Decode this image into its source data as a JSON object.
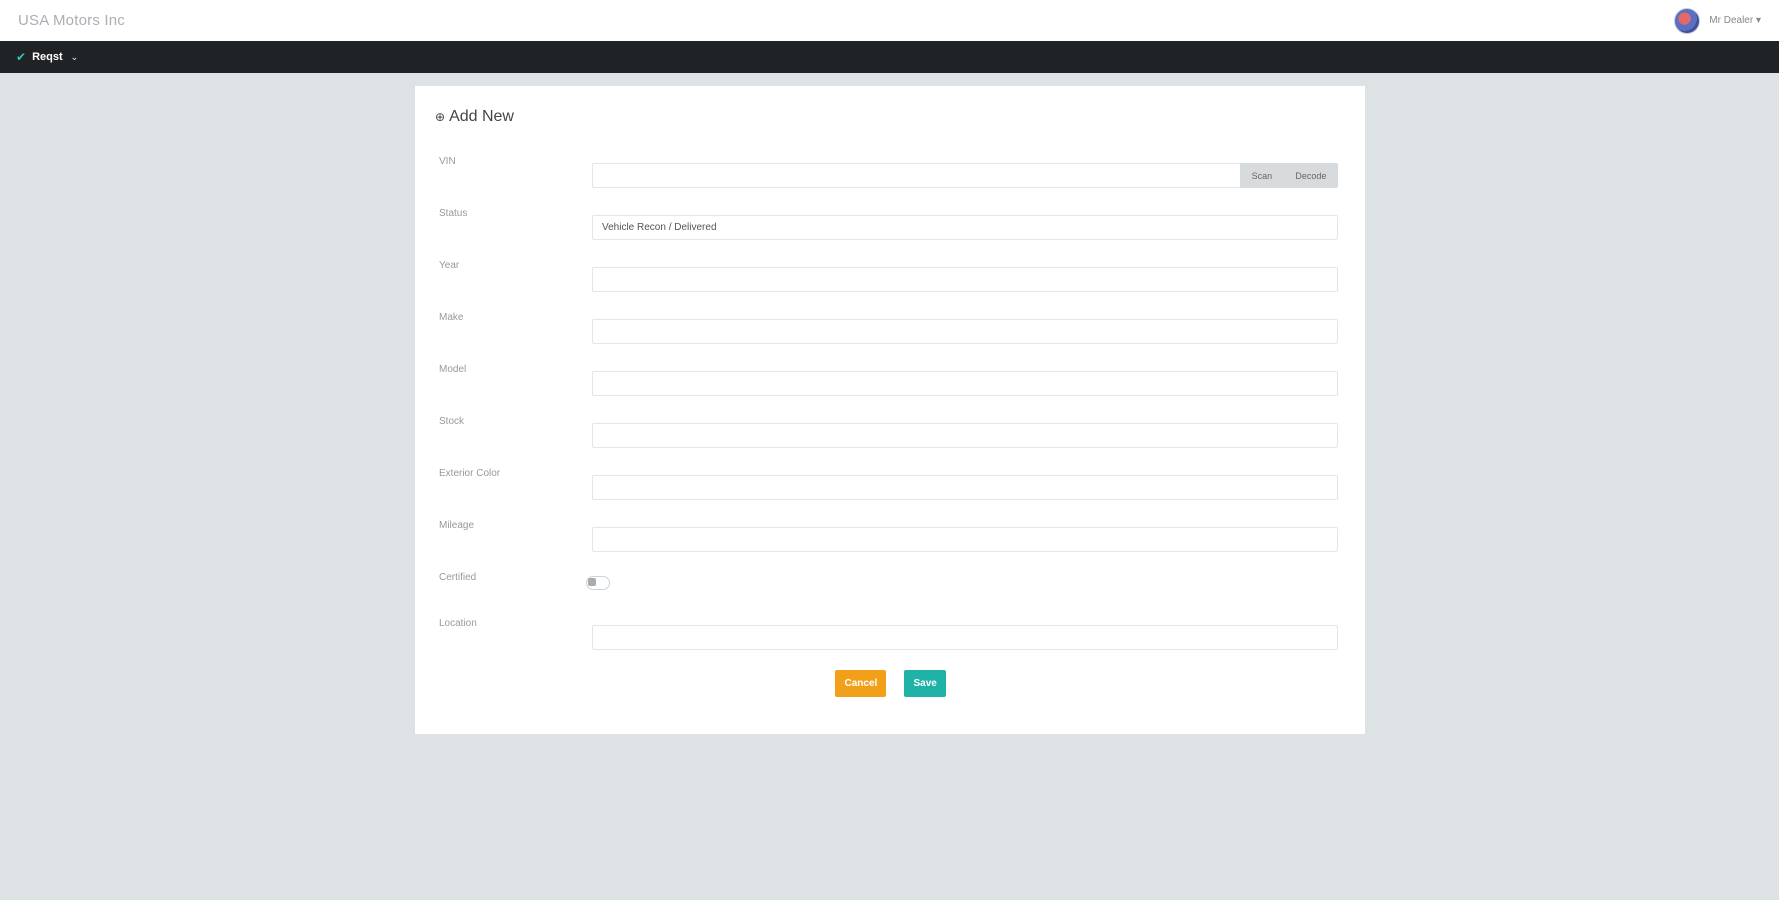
{
  "app": {
    "brand": "USA Motors Inc"
  },
  "user": {
    "name": "Mr Dealer ▾"
  },
  "nav": {
    "item_label": "Reqst"
  },
  "form": {
    "title": "Add New",
    "vin": {
      "label": "VIN",
      "value": "",
      "scan_label": "Scan",
      "decode_label": "Decode"
    },
    "status": {
      "label": "Status",
      "value": "Vehicle Recon / Delivered"
    },
    "year": {
      "label": "Year",
      "value": ""
    },
    "make": {
      "label": "Make",
      "value": ""
    },
    "model": {
      "label": "Model",
      "value": ""
    },
    "stock": {
      "label": "Stock",
      "value": ""
    },
    "exterior_color": {
      "label": "Exterior Color",
      "value": ""
    },
    "mileage": {
      "label": "Mileage",
      "value": ""
    },
    "certified": {
      "label": "Certified",
      "checked": false
    },
    "location": {
      "label": "Location",
      "value": ""
    },
    "cancel_label": "Cancel",
    "save_label": "Save"
  },
  "colors": {
    "accent": "#1fb2a7",
    "cancel": "#f2a01a",
    "navbar": "#1f2326",
    "background": "#dde2e5"
  }
}
